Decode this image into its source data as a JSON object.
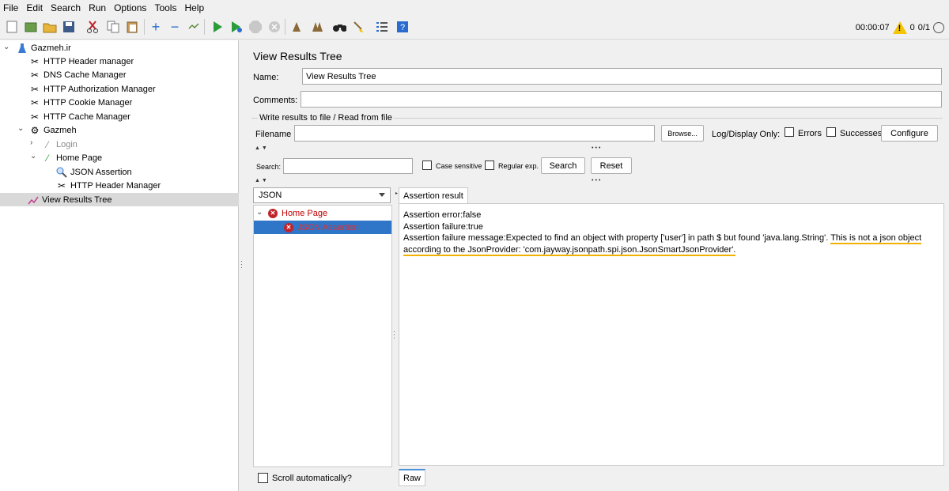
{
  "menu": [
    "File",
    "Edit",
    "Search",
    "Run",
    "Options",
    "Tools",
    "Help"
  ],
  "toolbar": {
    "timer": "00:00:07",
    "warning_count": "0",
    "threads": "0/1"
  },
  "tree": {
    "root": "Gazmeh.ir",
    "items": [
      {
        "label": "HTTP Header manager"
      },
      {
        "label": "DNS Cache Manager"
      },
      {
        "label": "HTTP Authorization Manager"
      },
      {
        "label": "HTTP Cookie Manager"
      },
      {
        "label": "HTTP Cache Manager"
      },
      {
        "label": "Gazmeh"
      },
      {
        "label": "Login"
      },
      {
        "label": "Home Page"
      },
      {
        "label": "JSON Assertion"
      },
      {
        "label": "HTTP Header Manager"
      },
      {
        "label": "View Results Tree"
      }
    ]
  },
  "panel": {
    "title": "View Results Tree",
    "name_label": "Name:",
    "name_value": "View Results Tree",
    "comments_label": "Comments:",
    "comments_value": "",
    "write_group": "Write results to file / Read from file",
    "filename_label": "Filename",
    "filename_value": "",
    "browse": "Browse...",
    "log_display": "Log/Display Only:",
    "errors": "Errors",
    "successes": "Successes",
    "configure": "Configure",
    "search_label": "Search:",
    "search_value": "",
    "case_sensitive": "Case sensitive",
    "regular_exp": "Regular exp.",
    "search_button": "Search",
    "reset_button": "Reset",
    "renderer": "JSON",
    "results": {
      "home": "Home Page",
      "assertion": "JSON Assertion"
    },
    "scroll_auto": "Scroll automatically?",
    "tab_assertion": "Assertion result",
    "tab_raw": "Raw",
    "assertion": {
      "line1": "Assertion error:false",
      "line2": "Assertion failure:true",
      "line3_prefix": "Assertion failure message:Expected to find an object with property ['user'] in path $ but found 'java.lang.String'.",
      "line3_highlight": "This is not a json object",
      "line4": "according to the JsonProvider: 'com.jayway.jsonpath.spi.json.JsonSmartJsonProvider'."
    }
  },
  "colors": {
    "error": "#c00000",
    "selection": "#2f75c8",
    "highlight_underline": "#f2b100"
  }
}
